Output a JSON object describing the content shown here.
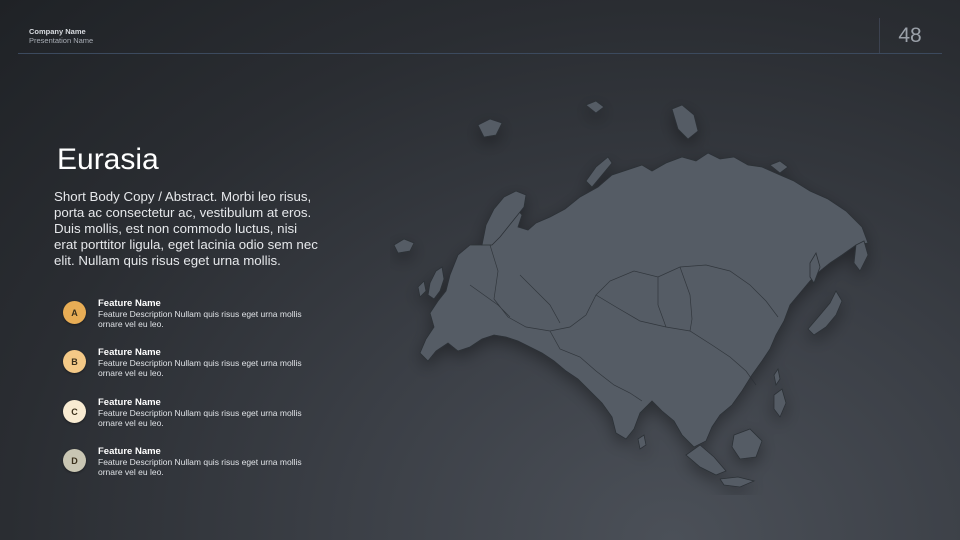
{
  "header": {
    "company": "Company Name",
    "presentation": "Presentation Name",
    "page_number": "48"
  },
  "main": {
    "title": "Eurasia",
    "body": "Short Body Copy / Abstract.  Morbi leo risus, porta ac consectetur ac, vestibulum at eros. Duis mollis, est non commodo luctus, nisi erat porttitor ligula, eget lacinia odio sem nec elit. Nullam quis risus eget urna mollis."
  },
  "features": [
    {
      "letter": "A",
      "name": "Feature Name",
      "description": "Feature Description Nullam quis risus eget urna mollis ornare vel eu leo.",
      "color": "#e8ad55"
    },
    {
      "letter": "B",
      "name": "Feature Name",
      "description": "Feature Description Nullam quis risus eget urna mollis ornare vel eu leo.",
      "color": "#f4c987"
    },
    {
      "letter": "C",
      "name": "Feature Name",
      "description": "Feature Description Nullam quis risus eget urna mollis ornare vel eu leo.",
      "color": "#f8ebd2"
    },
    {
      "letter": "D",
      "name": "Feature Name",
      "description": "Feature Description Nullam quis risus eget urna mollis ornare vel eu leo.",
      "color": "#c9c6b3"
    }
  ],
  "map": {
    "region": "Eurasia",
    "land_color": "#555b65",
    "border_color": "#2c3036"
  }
}
